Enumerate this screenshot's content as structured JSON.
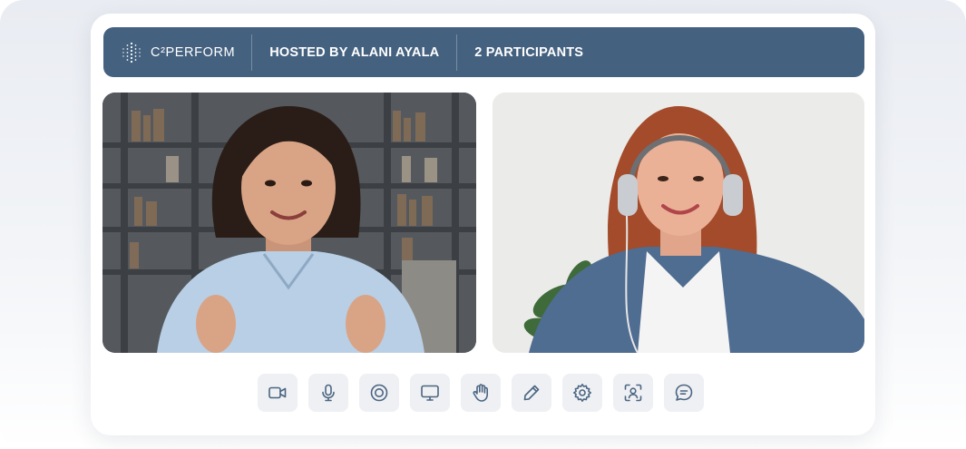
{
  "header": {
    "brand": "C²PERFORM",
    "host": "HOSTED BY ALANI AYALA",
    "participants": "2 PARTICIPANTS"
  },
  "colors": {
    "header_bg": "#44617f",
    "control_bg": "#eef0f3",
    "icon": "#4b6582"
  },
  "controls": [
    {
      "name": "camera",
      "icon": "video-camera-icon"
    },
    {
      "name": "microphone",
      "icon": "microphone-icon"
    },
    {
      "name": "record",
      "icon": "record-icon"
    },
    {
      "name": "screen-share",
      "icon": "monitor-icon"
    },
    {
      "name": "raise-hand",
      "icon": "hand-icon"
    },
    {
      "name": "annotate",
      "icon": "pen-icon"
    },
    {
      "name": "settings",
      "icon": "gear-icon"
    },
    {
      "name": "focus-view",
      "icon": "person-frame-icon"
    },
    {
      "name": "chat",
      "icon": "chat-icon"
    }
  ]
}
